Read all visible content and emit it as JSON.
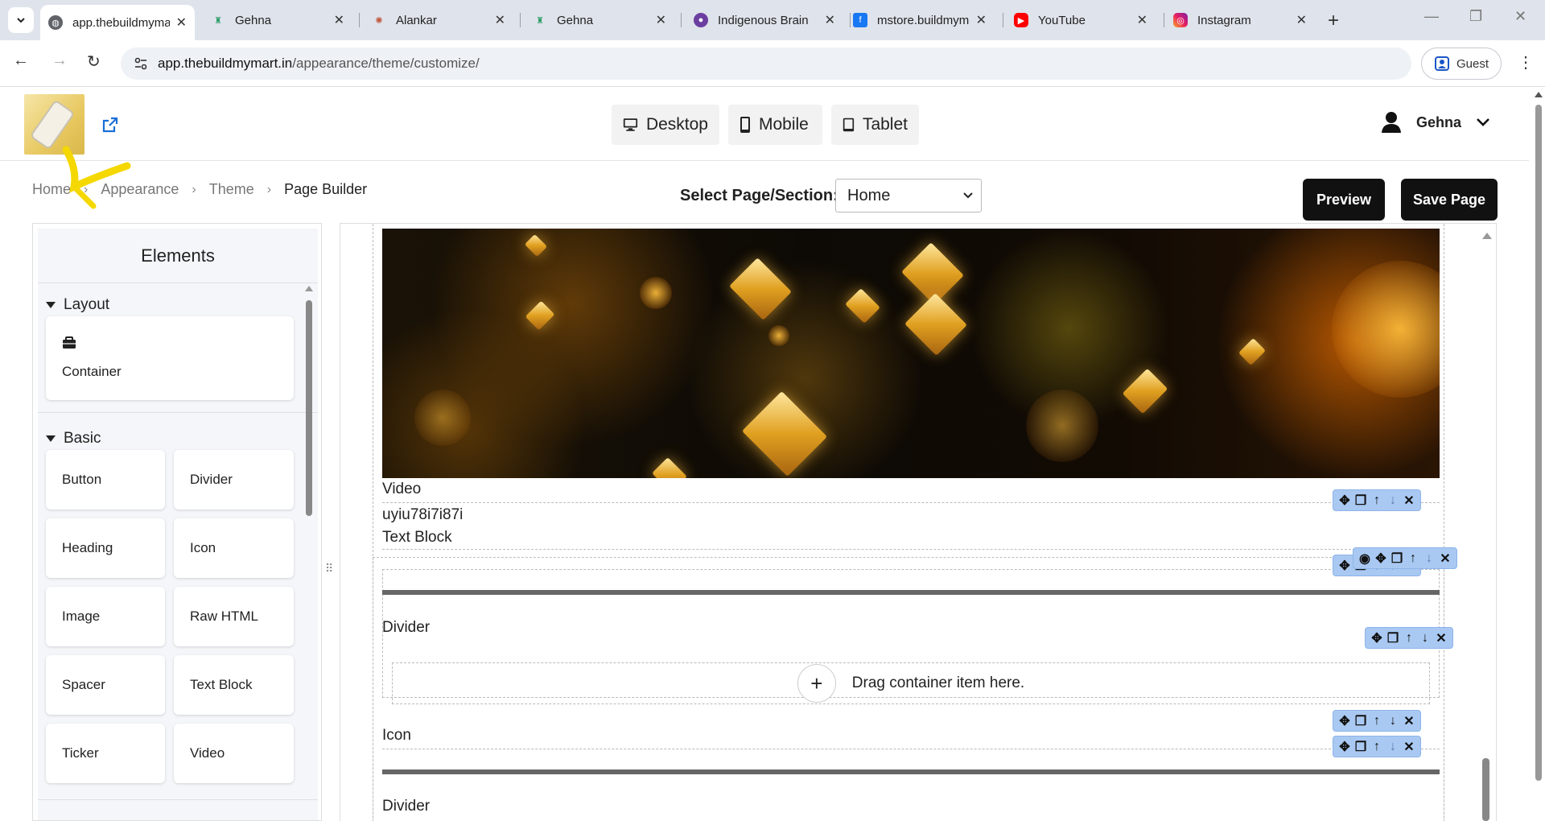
{
  "browser": {
    "tabs": [
      {
        "title": "app.thebuildmymart.in",
        "favicon": "globe-icon",
        "active": true
      },
      {
        "title": "Gehna",
        "favicon": "gehna-icon"
      },
      {
        "title": "Alankar",
        "favicon": "alankar-icon"
      },
      {
        "title": "Gehna",
        "favicon": "gehna-icon"
      },
      {
        "title": "Indigenous Brain",
        "favicon": "indigenous-icon"
      },
      {
        "title": "mstore.buildmymart",
        "favicon": "facebook-icon"
      },
      {
        "title": "YouTube",
        "favicon": "youtube-icon"
      },
      {
        "title": "Instagram",
        "favicon": "instagram-icon"
      }
    ],
    "url_host": "app.thebuildmymart.in",
    "url_path": "/appearance/theme/customize/",
    "profile_label": "Guest"
  },
  "header": {
    "devices": [
      {
        "label": "Desktop",
        "icon": "desktop-icon"
      },
      {
        "label": "Mobile",
        "icon": "mobile-icon"
      },
      {
        "label": "Tablet",
        "icon": "tablet-icon"
      }
    ],
    "user_name": "Gehna"
  },
  "breadcrumb": {
    "items": [
      "Home",
      "Appearance",
      "Theme"
    ],
    "current": "Page Builder"
  },
  "page_selector": {
    "label": "Select Page/Section:",
    "selected": "Home"
  },
  "actions": {
    "preview": "Preview",
    "save": "Save Page"
  },
  "elements_panel": {
    "title": "Elements",
    "sections": [
      {
        "name": "Layout",
        "items": [
          "Container"
        ]
      },
      {
        "name": "Basic",
        "items": [
          "Button",
          "Divider",
          "Heading",
          "Icon",
          "Image",
          "Raw HTML",
          "Spacer",
          "Text Block",
          "Ticker",
          "Video"
        ]
      }
    ]
  },
  "canvas": {
    "labels": {
      "video": "Video",
      "text_value": "uyiu78i7i87i",
      "text_block": "Text Block",
      "divider_1": "Divider",
      "drop_hint": "Drag container item here.",
      "icon": "Icon",
      "divider_2": "Divider"
    }
  },
  "colors": {
    "toolbar_bg": "#a9c9f2",
    "button_dark": "#111111",
    "annotation": "#f5d800"
  }
}
